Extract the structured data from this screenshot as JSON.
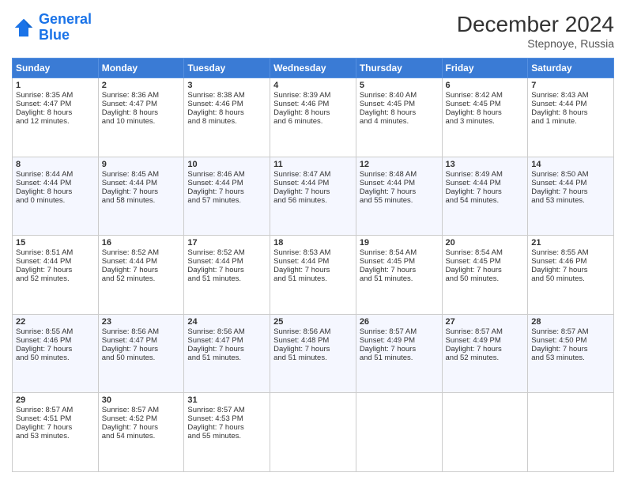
{
  "header": {
    "logo_line1": "General",
    "logo_line2": "Blue",
    "month": "December 2024",
    "location": "Stepnoye, Russia"
  },
  "weekdays": [
    "Sunday",
    "Monday",
    "Tuesday",
    "Wednesday",
    "Thursday",
    "Friday",
    "Saturday"
  ],
  "weeks": [
    [
      {
        "day": "1",
        "lines": [
          "Sunrise: 8:35 AM",
          "Sunset: 4:47 PM",
          "Daylight: 8 hours",
          "and 12 minutes."
        ]
      },
      {
        "day": "2",
        "lines": [
          "Sunrise: 8:36 AM",
          "Sunset: 4:47 PM",
          "Daylight: 8 hours",
          "and 10 minutes."
        ]
      },
      {
        "day": "3",
        "lines": [
          "Sunrise: 8:38 AM",
          "Sunset: 4:46 PM",
          "Daylight: 8 hours",
          "and 8 minutes."
        ]
      },
      {
        "day": "4",
        "lines": [
          "Sunrise: 8:39 AM",
          "Sunset: 4:46 PM",
          "Daylight: 8 hours",
          "and 6 minutes."
        ]
      },
      {
        "day": "5",
        "lines": [
          "Sunrise: 8:40 AM",
          "Sunset: 4:45 PM",
          "Daylight: 8 hours",
          "and 4 minutes."
        ]
      },
      {
        "day": "6",
        "lines": [
          "Sunrise: 8:42 AM",
          "Sunset: 4:45 PM",
          "Daylight: 8 hours",
          "and 3 minutes."
        ]
      },
      {
        "day": "7",
        "lines": [
          "Sunrise: 8:43 AM",
          "Sunset: 4:44 PM",
          "Daylight: 8 hours",
          "and 1 minute."
        ]
      }
    ],
    [
      {
        "day": "8",
        "lines": [
          "Sunrise: 8:44 AM",
          "Sunset: 4:44 PM",
          "Daylight: 8 hours",
          "and 0 minutes."
        ]
      },
      {
        "day": "9",
        "lines": [
          "Sunrise: 8:45 AM",
          "Sunset: 4:44 PM",
          "Daylight: 7 hours",
          "and 58 minutes."
        ]
      },
      {
        "day": "10",
        "lines": [
          "Sunrise: 8:46 AM",
          "Sunset: 4:44 PM",
          "Daylight: 7 hours",
          "and 57 minutes."
        ]
      },
      {
        "day": "11",
        "lines": [
          "Sunrise: 8:47 AM",
          "Sunset: 4:44 PM",
          "Daylight: 7 hours",
          "and 56 minutes."
        ]
      },
      {
        "day": "12",
        "lines": [
          "Sunrise: 8:48 AM",
          "Sunset: 4:44 PM",
          "Daylight: 7 hours",
          "and 55 minutes."
        ]
      },
      {
        "day": "13",
        "lines": [
          "Sunrise: 8:49 AM",
          "Sunset: 4:44 PM",
          "Daylight: 7 hours",
          "and 54 minutes."
        ]
      },
      {
        "day": "14",
        "lines": [
          "Sunrise: 8:50 AM",
          "Sunset: 4:44 PM",
          "Daylight: 7 hours",
          "and 53 minutes."
        ]
      }
    ],
    [
      {
        "day": "15",
        "lines": [
          "Sunrise: 8:51 AM",
          "Sunset: 4:44 PM",
          "Daylight: 7 hours",
          "and 52 minutes."
        ]
      },
      {
        "day": "16",
        "lines": [
          "Sunrise: 8:52 AM",
          "Sunset: 4:44 PM",
          "Daylight: 7 hours",
          "and 52 minutes."
        ]
      },
      {
        "day": "17",
        "lines": [
          "Sunrise: 8:52 AM",
          "Sunset: 4:44 PM",
          "Daylight: 7 hours",
          "and 51 minutes."
        ]
      },
      {
        "day": "18",
        "lines": [
          "Sunrise: 8:53 AM",
          "Sunset: 4:44 PM",
          "Daylight: 7 hours",
          "and 51 minutes."
        ]
      },
      {
        "day": "19",
        "lines": [
          "Sunrise: 8:54 AM",
          "Sunset: 4:45 PM",
          "Daylight: 7 hours",
          "and 51 minutes."
        ]
      },
      {
        "day": "20",
        "lines": [
          "Sunrise: 8:54 AM",
          "Sunset: 4:45 PM",
          "Daylight: 7 hours",
          "and 50 minutes."
        ]
      },
      {
        "day": "21",
        "lines": [
          "Sunrise: 8:55 AM",
          "Sunset: 4:46 PM",
          "Daylight: 7 hours",
          "and 50 minutes."
        ]
      }
    ],
    [
      {
        "day": "22",
        "lines": [
          "Sunrise: 8:55 AM",
          "Sunset: 4:46 PM",
          "Daylight: 7 hours",
          "and 50 minutes."
        ]
      },
      {
        "day": "23",
        "lines": [
          "Sunrise: 8:56 AM",
          "Sunset: 4:47 PM",
          "Daylight: 7 hours",
          "and 50 minutes."
        ]
      },
      {
        "day": "24",
        "lines": [
          "Sunrise: 8:56 AM",
          "Sunset: 4:47 PM",
          "Daylight: 7 hours",
          "and 51 minutes."
        ]
      },
      {
        "day": "25",
        "lines": [
          "Sunrise: 8:56 AM",
          "Sunset: 4:48 PM",
          "Daylight: 7 hours",
          "and 51 minutes."
        ]
      },
      {
        "day": "26",
        "lines": [
          "Sunrise: 8:57 AM",
          "Sunset: 4:49 PM",
          "Daylight: 7 hours",
          "and 51 minutes."
        ]
      },
      {
        "day": "27",
        "lines": [
          "Sunrise: 8:57 AM",
          "Sunset: 4:49 PM",
          "Daylight: 7 hours",
          "and 52 minutes."
        ]
      },
      {
        "day": "28",
        "lines": [
          "Sunrise: 8:57 AM",
          "Sunset: 4:50 PM",
          "Daylight: 7 hours",
          "and 53 minutes."
        ]
      }
    ],
    [
      {
        "day": "29",
        "lines": [
          "Sunrise: 8:57 AM",
          "Sunset: 4:51 PM",
          "Daylight: 7 hours",
          "and 53 minutes."
        ]
      },
      {
        "day": "30",
        "lines": [
          "Sunrise: 8:57 AM",
          "Sunset: 4:52 PM",
          "Daylight: 7 hours",
          "and 54 minutes."
        ]
      },
      {
        "day": "31",
        "lines": [
          "Sunrise: 8:57 AM",
          "Sunset: 4:53 PM",
          "Daylight: 7 hours",
          "and 55 minutes."
        ]
      },
      null,
      null,
      null,
      null
    ]
  ]
}
